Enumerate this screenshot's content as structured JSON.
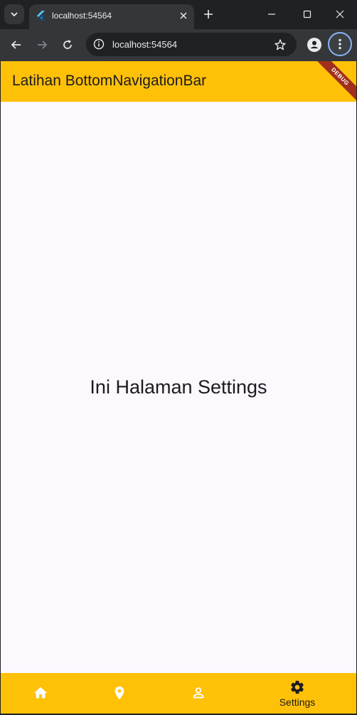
{
  "browser": {
    "tab_title": "localhost:54564",
    "url": "localhost:54564"
  },
  "app": {
    "appbar_title": "Latihan BottomNavigationBar",
    "debug_banner": "DEBUG",
    "body_text": "Ini Halaman Settings",
    "bottom_nav": {
      "selected_index": 3,
      "items": [
        {
          "icon": "home-icon",
          "label": ""
        },
        {
          "icon": "location-pin-icon",
          "label": ""
        },
        {
          "icon": "person-icon",
          "label": ""
        },
        {
          "icon": "settings-gear-icon",
          "label": "Settings"
        }
      ]
    },
    "colors": {
      "accent": "#ffc107",
      "background": "#fdf7fe",
      "text": "#1d1b20"
    }
  }
}
